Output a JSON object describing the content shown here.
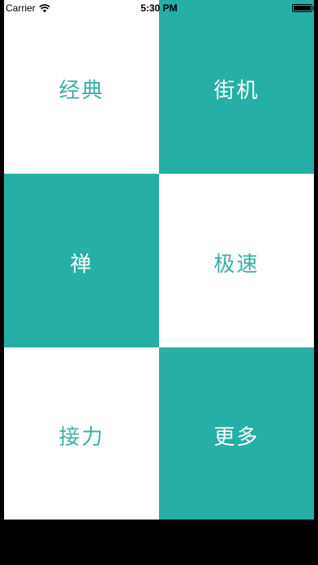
{
  "status_bar": {
    "carrier": "Carrier",
    "time": "5:30 PM",
    "battery_level": 1.0
  },
  "colors": {
    "teal": "#25afa6",
    "teal_text": "#3ab0a8",
    "white": "#ffffff"
  },
  "tiles": [
    {
      "label": "经典",
      "style": "light"
    },
    {
      "label": "街机",
      "style": "teal"
    },
    {
      "label": "禅",
      "style": "teal"
    },
    {
      "label": "极速",
      "style": "light"
    },
    {
      "label": "接力",
      "style": "light"
    },
    {
      "label": "更多",
      "style": "teal"
    }
  ]
}
